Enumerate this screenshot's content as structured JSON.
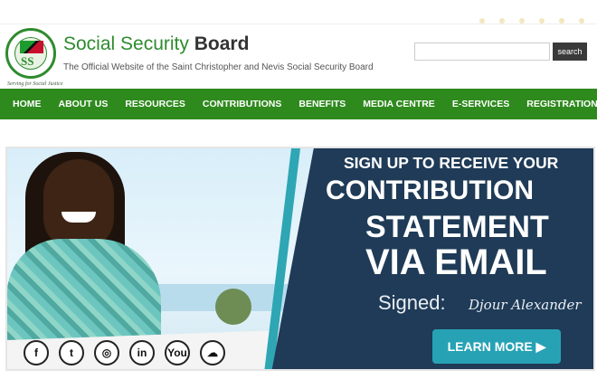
{
  "header": {
    "title_main": "Social Security ",
    "title_bold": "Board",
    "subtitle": "The Official Website of the Saint Christopher and Nevis Social Security Board",
    "logo_text": "SS",
    "logo_tagline": "Serving for Social Justice"
  },
  "search": {
    "placeholder": "",
    "button_label": "search"
  },
  "nav": {
    "items": [
      "HOME",
      "ABOUT US",
      "RESOURCES",
      "CONTRIBUTIONS",
      "BENEFITS",
      "MEDIA CENTRE",
      "E-SERVICES",
      "REGISTRATION"
    ]
  },
  "banner": {
    "line1": "SIGN UP TO RECEIVE YOUR",
    "line2": "CONTRIBUTION",
    "line3": "STATEMENT",
    "line4": "VIA EMAIL",
    "signed_label": "Signed:",
    "signature": "Djour Alexander",
    "cta_label": "LEARN MORE ▶",
    "social_icons": [
      {
        "name": "facebook-icon",
        "glyph": "f"
      },
      {
        "name": "twitter-icon",
        "glyph": "t"
      },
      {
        "name": "instagram-icon",
        "glyph": "◎"
      },
      {
        "name": "linkedin-icon",
        "glyph": "in"
      },
      {
        "name": "youtube-icon",
        "glyph": "You"
      },
      {
        "name": "soundcloud-icon",
        "glyph": "☁"
      }
    ]
  },
  "colors": {
    "brand_green": "#2f8a1e",
    "banner_navy": "#1f3b57",
    "accent_teal": "#27a2b5"
  }
}
